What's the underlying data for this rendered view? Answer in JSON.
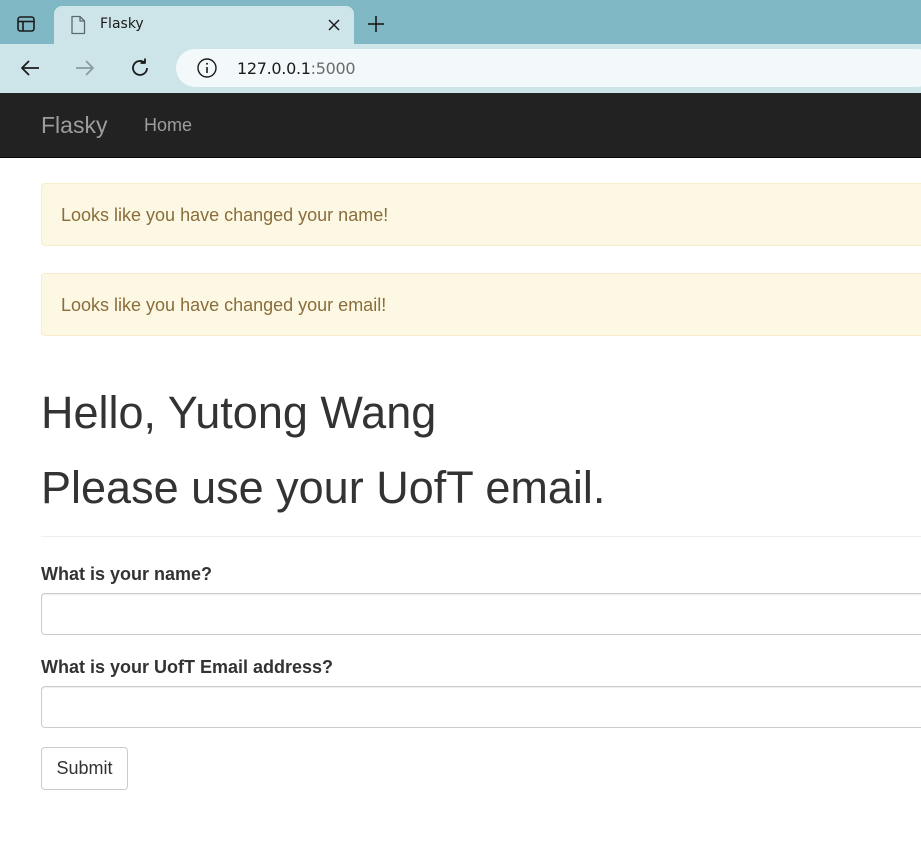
{
  "browser": {
    "tab_title": "Flasky",
    "url_host": "127.0.0.1",
    "url_port": ":5000",
    "icons": [
      "tab-actions-icon",
      "page-icon",
      "close-icon",
      "plus-icon",
      "back-arrow-icon",
      "forward-arrow-icon",
      "reload-icon",
      "info-icon"
    ]
  },
  "navbar": {
    "brand": "Flasky",
    "links": [
      {
        "label": "Home"
      }
    ]
  },
  "alerts": [
    {
      "text": "Looks like you have changed your name!"
    },
    {
      "text": "Looks like you have changed your email!"
    }
  ],
  "page": {
    "greeting": "Hello, Yutong Wang",
    "subheading": "Please use your UofT email."
  },
  "form": {
    "name_label": "What is your name?",
    "name_value": "",
    "email_label": "What is your UofT Email address?",
    "email_value": "",
    "submit_label": "Submit"
  },
  "colors": {
    "tabbar": "#7fb8c4",
    "toolbar": "#cde5e9",
    "navbar": "#222222",
    "alert_bg": "#fcf8e3",
    "alert_text": "#8a6d3b"
  }
}
